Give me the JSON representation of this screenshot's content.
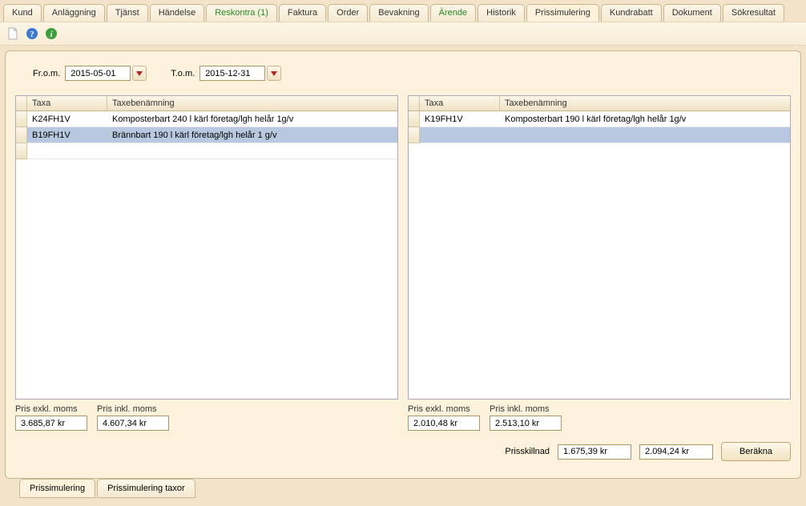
{
  "topTabs": [
    {
      "label": "Kund",
      "active": false,
      "green": false
    },
    {
      "label": "Anläggning",
      "active": false,
      "green": false
    },
    {
      "label": "Tjänst",
      "active": false,
      "green": false
    },
    {
      "label": "Händelse",
      "active": false,
      "green": false
    },
    {
      "label": "Reskontra (1)",
      "active": false,
      "green": true
    },
    {
      "label": "Faktura",
      "active": false,
      "green": false
    },
    {
      "label": "Order",
      "active": false,
      "green": false
    },
    {
      "label": "Bevakning",
      "active": false,
      "green": false
    },
    {
      "label": "Ärende",
      "active": false,
      "green": true
    },
    {
      "label": "Historik",
      "active": false,
      "green": false
    },
    {
      "label": "Prissimulering",
      "active": true,
      "green": false
    },
    {
      "label": "Kundrabatt",
      "active": false,
      "green": false
    },
    {
      "label": "Dokument",
      "active": false,
      "green": false
    },
    {
      "label": "Sökresultat",
      "active": false,
      "green": false
    }
  ],
  "dates": {
    "fromLabel": "Fr.o.m.",
    "fromValue": "2015-05-01",
    "toLabel": "T.o.m.",
    "toValue": "2015-12-31"
  },
  "columns": {
    "taxa": "Taxa",
    "benamn": "Taxebenämning"
  },
  "leftRows": [
    {
      "taxa": "K24FH1V",
      "benamn": "Komposterbart 240 l kärl företag/lgh helår 1g/v",
      "selected": false
    },
    {
      "taxa": "B19FH1V",
      "benamn": "Brännbart 190 l kärl företag/lgh helår 1 g/v",
      "selected": true
    }
  ],
  "rightRows": [
    {
      "taxa": "K19FH1V",
      "benamn": "Komposterbart 190 l kärl företag/lgh helår 1g/v",
      "selected": false
    }
  ],
  "totals": {
    "exklLabel": "Pris exkl. moms",
    "inklLabel": "Pris inkl. moms",
    "leftExkl": "3.685,87 kr",
    "leftInkl": "4.607,34 kr",
    "rightExkl": "2.010,48 kr",
    "rightInkl": "2.513,10 kr"
  },
  "diff": {
    "label": "Prisskillnad",
    "exkl": "1.675,39 kr",
    "inkl": "2.094,24 kr"
  },
  "buttons": {
    "calc": "Beräkna"
  },
  "bottomTabs": [
    {
      "label": "Prissimulering",
      "active": true
    },
    {
      "label": "Prissimulering taxor",
      "active": false
    }
  ]
}
